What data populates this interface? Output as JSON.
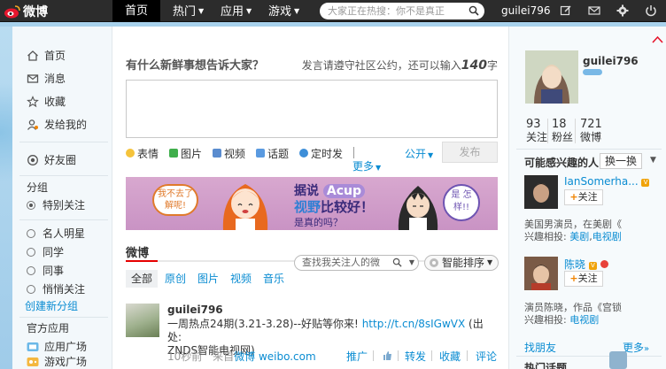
{
  "topbar": {
    "logo_text": "微博",
    "nav": [
      {
        "label": "首页",
        "active": true
      },
      {
        "label": "热门",
        "caret": true
      },
      {
        "label": "应用",
        "caret": true
      },
      {
        "label": "游戏",
        "caret": true
      }
    ],
    "search_placeholder": "大家正在热搜：你不是真正",
    "username": "guilei796"
  },
  "left_menu": {
    "items": [
      {
        "label": "首页",
        "icon": "home-icon"
      },
      {
        "label": "消息",
        "icon": "mail-icon"
      },
      {
        "label": "收藏",
        "icon": "star-icon"
      },
      {
        "label": "发给我的",
        "icon": "person-icon"
      }
    ],
    "friends_circle": "好友圈",
    "group_heading": "分组",
    "groups": [
      {
        "label": "特别关注",
        "selected": true
      },
      {
        "label": "名人明星"
      },
      {
        "label": "同学"
      },
      {
        "label": "同事"
      },
      {
        "label": "悄悄关注"
      }
    ],
    "create_group": "创建新分组",
    "apps_heading": "官方应用",
    "apps": [
      {
        "label": "应用广场"
      },
      {
        "label": "游戏广场"
      }
    ]
  },
  "composer": {
    "prompt": "有什么新鲜事想告诉大家？",
    "tip_prefix": "发言请遵守社区公约，还可以输入",
    "tip_count": "140",
    "tip_suffix": "字",
    "tools": [
      "表情",
      "图片",
      "视频",
      "话题",
      "定时发"
    ],
    "more": "更多",
    "visibility": "公开",
    "post_button": "发布"
  },
  "banner": {
    "left_bubble": "我不去了解呢!",
    "line1_a": "据说",
    "line1_b": "Acup",
    "line2_a": "视野",
    "line2_b": "比较好！",
    "line3": "是真的吗？",
    "right_bubble": "是 怎样!!"
  },
  "feed": {
    "title": "微博",
    "search_placeholder": "查找我关注人的微",
    "sort_label": "智能排序",
    "filters": [
      "全部",
      "原创",
      "图片",
      "视频",
      "音乐"
    ],
    "post": {
      "author": "guilei796",
      "text_main": "一周热点24期(3.21-3.28)--好贴等你来!",
      "link": "http://t.cn/8sIGwVX",
      "text_tail_a": "(出处:",
      "text_tail_b": "ZNDS智能电视网)",
      "time": "10秒前",
      "source_prefix": "来自",
      "source": "微博 weibo.com",
      "actions": [
        "推广",
        "转发",
        "收藏",
        "评论"
      ]
    }
  },
  "profile": {
    "name": "guilei796",
    "stats": [
      {
        "value": "93",
        "label": "关注"
      },
      {
        "value": "18",
        "label": "粉丝"
      },
      {
        "value": "721",
        "label": "微博"
      }
    ]
  },
  "recommend": {
    "title": "可能感兴趣的人",
    "swap": "换一换",
    "people": [
      {
        "name": "IanSomerha...",
        "follow": "关注",
        "desc_prefix": "美国男演员，在美剧《",
        "desc_mid": "兴趣相投: ",
        "tag1": "美剧",
        "sep": ",",
        "tag2": "电视剧"
      },
      {
        "name": "陈晓",
        "follow": "关注",
        "desc_prefix": "演员陈晓，作品《宫锁",
        "desc_mid": "兴趣相投: ",
        "tag1": "电视剧",
        "sep": "",
        "tag2": ""
      }
    ],
    "find_friends": "找朋友",
    "more": "更多",
    "trending": "热门话题"
  }
}
